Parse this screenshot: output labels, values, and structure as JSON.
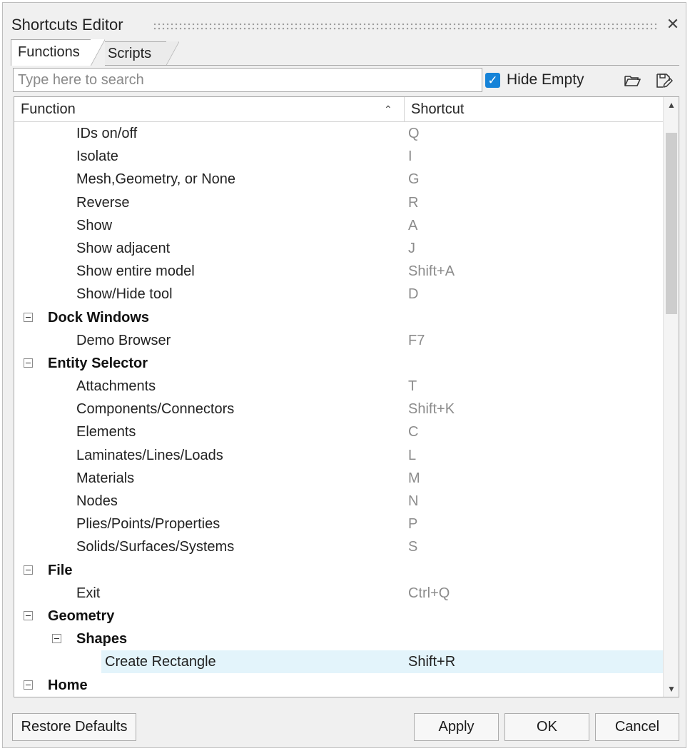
{
  "window": {
    "title": "Shortcuts Editor",
    "close_glyph": "✕"
  },
  "tabs": [
    {
      "label": "Functions",
      "active": true
    },
    {
      "label": "Scripts",
      "active": false
    }
  ],
  "search": {
    "placeholder": "Type here to search",
    "value": ""
  },
  "hide_empty": {
    "label": "Hide Empty",
    "checked": true,
    "check_glyph": "✓"
  },
  "toolbar": {
    "open_icon": "folder-open-icon",
    "save_icon": "save-edit-icon"
  },
  "table": {
    "columns": [
      {
        "label": "Function",
        "sort": "ascending",
        "sort_glyph": "⌃"
      },
      {
        "label": "Shortcut"
      }
    ],
    "rows": [
      {
        "level": 2,
        "type": "item",
        "label": "IDs on/off",
        "shortcut": "Q"
      },
      {
        "level": 2,
        "type": "item",
        "label": "Isolate",
        "shortcut": "I"
      },
      {
        "level": 2,
        "type": "item",
        "label": "Mesh,Geometry, or None",
        "shortcut": "G"
      },
      {
        "level": 2,
        "type": "item",
        "label": "Reverse",
        "shortcut": "R"
      },
      {
        "level": 2,
        "type": "item",
        "label": "Show",
        "shortcut": "A"
      },
      {
        "level": 2,
        "type": "item",
        "label": "Show adjacent",
        "shortcut": "J"
      },
      {
        "level": 2,
        "type": "item",
        "label": "Show entire model",
        "shortcut": "Shift+A"
      },
      {
        "level": 2,
        "type": "item",
        "label": "Show/Hide tool",
        "shortcut": "D"
      },
      {
        "level": 1,
        "type": "group",
        "label": "Dock Windows",
        "shortcut": ""
      },
      {
        "level": 2,
        "type": "item",
        "label": "Demo Browser",
        "shortcut": "F7"
      },
      {
        "level": 1,
        "type": "group",
        "label": "Entity Selector",
        "shortcut": ""
      },
      {
        "level": 2,
        "type": "item",
        "label": "Attachments",
        "shortcut": "T"
      },
      {
        "level": 2,
        "type": "item",
        "label": "Components/Connectors",
        "shortcut": "Shift+K"
      },
      {
        "level": 2,
        "type": "item",
        "label": "Elements",
        "shortcut": "C"
      },
      {
        "level": 2,
        "type": "item",
        "label": "Laminates/Lines/Loads",
        "shortcut": "L"
      },
      {
        "level": 2,
        "type": "item",
        "label": "Materials",
        "shortcut": "M"
      },
      {
        "level": 2,
        "type": "item",
        "label": "Nodes",
        "shortcut": "N"
      },
      {
        "level": 2,
        "type": "item",
        "label": "Plies/Points/Properties",
        "shortcut": "P"
      },
      {
        "level": 2,
        "type": "item",
        "label": "Solids/Surfaces/Systems",
        "shortcut": "S"
      },
      {
        "level": 1,
        "type": "group",
        "label": "File",
        "shortcut": ""
      },
      {
        "level": 2,
        "type": "item",
        "label": "Exit",
        "shortcut": "Ctrl+Q"
      },
      {
        "level": 1,
        "type": "group",
        "label": "Geometry",
        "shortcut": ""
      },
      {
        "level": 2,
        "type": "group",
        "label": "Shapes",
        "shortcut": ""
      },
      {
        "level": 3,
        "type": "item",
        "label": "Create Rectangle",
        "shortcut": "Shift+R",
        "selected": true
      },
      {
        "level": 1,
        "type": "group",
        "label": "Home",
        "shortcut": ""
      }
    ]
  },
  "scrollbar": {
    "up_glyph": "▲",
    "down_glyph": "▼",
    "position": 0.0
  },
  "buttons": {
    "restore_defaults": "Restore Defaults",
    "apply": "Apply",
    "ok": "OK",
    "cancel": "Cancel"
  },
  "colors": {
    "selection": "#e3f4fb",
    "checkbox": "#1683d8",
    "shortcut_text": "#8c8c8c"
  }
}
